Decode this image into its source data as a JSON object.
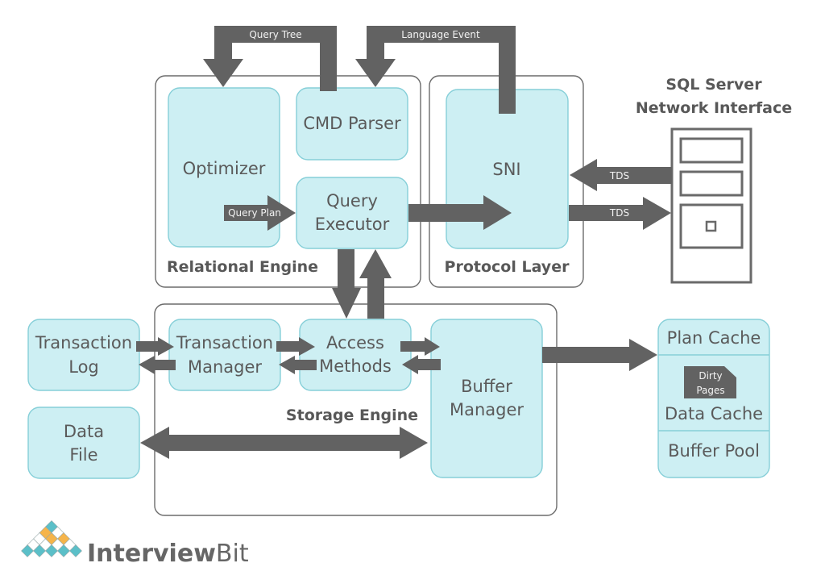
{
  "diagram": {
    "groups": {
      "relational_engine": "Relational Engine",
      "protocol_layer": "Protocol Layer",
      "storage_engine": "Storage Engine"
    },
    "components": {
      "optimizer": "Optimizer",
      "cmd_parser": "CMD Parser",
      "query_executor": [
        "Query",
        "Executor"
      ],
      "sni": "SNI",
      "transaction_log": [
        "Transaction",
        "Log"
      ],
      "transaction_manager": [
        "Transaction",
        "Manager"
      ],
      "access_methods": [
        "Access",
        "Methods"
      ],
      "buffer_manager": [
        "Buffer",
        "Manager"
      ],
      "data_file": [
        "Data",
        "File"
      ]
    },
    "buffer_pool_box": {
      "plan_cache": "Plan Cache",
      "dirty_pages": [
        "Dirty",
        "Pages"
      ],
      "data_cache": "Data Cache",
      "buffer_pool": "Buffer Pool"
    },
    "network_interface": [
      "SQL Server",
      "Network Interface"
    ],
    "arrow_labels": {
      "query_tree": "Query Tree",
      "language_event": "Language Event",
      "query_plan": "Query Plan",
      "tds_in": "TDS",
      "tds_out": "TDS"
    },
    "colors": {
      "component_fill": "#cdeff3",
      "component_border": "#86cfd8",
      "arrow": "#626262",
      "logo_teal": "#5bbfc8",
      "logo_orange": "#f5b44a"
    }
  },
  "brand": {
    "name_bold": "Interview",
    "name_light": "Bit"
  }
}
